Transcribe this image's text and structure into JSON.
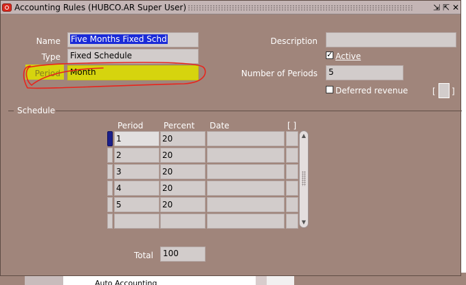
{
  "window": {
    "title": "Accounting Rules (HUBCO.AR Super User)",
    "buttons": [
      "minimize",
      "maximize",
      "close"
    ]
  },
  "form": {
    "name_label": "Name",
    "name_value": "Five Months Fixed Schd",
    "type_label": "Type",
    "type_value": "Fixed Schedule",
    "period_label": "Period",
    "period_value": "Month",
    "description_label": "Description",
    "description_value": "",
    "active_label": "Active",
    "active_checked": true,
    "num_periods_label": "Number of Periods",
    "num_periods_value": "5",
    "deferred_label": "Deferred revenue",
    "deferred_checked": false,
    "bracket_left": "[",
    "bracket_right": "]"
  },
  "schedule": {
    "title": "Schedule",
    "columns": {
      "period": "Period",
      "percent": "Percent",
      "date": "Date",
      "flex": "[ ]"
    },
    "rows": [
      {
        "period": "1",
        "percent": "20",
        "date": ""
      },
      {
        "period": "2",
        "percent": "20",
        "date": ""
      },
      {
        "period": "3",
        "percent": "20",
        "date": ""
      },
      {
        "period": "4",
        "percent": "20",
        "date": ""
      },
      {
        "period": "5",
        "percent": "20",
        "date": ""
      },
      {
        "period": "",
        "percent": "",
        "date": ""
      }
    ],
    "total_label": "Total",
    "total_value": "100"
  },
  "background": {
    "partial_text": "Auto Accounting"
  },
  "colors": {
    "window_bg": "#a0857b",
    "field_bg": "#d2cccb",
    "highlight_yellow": "#d6d40e",
    "selection_blue": "#1a2bd8",
    "annotation_red": "#e8241c"
  }
}
